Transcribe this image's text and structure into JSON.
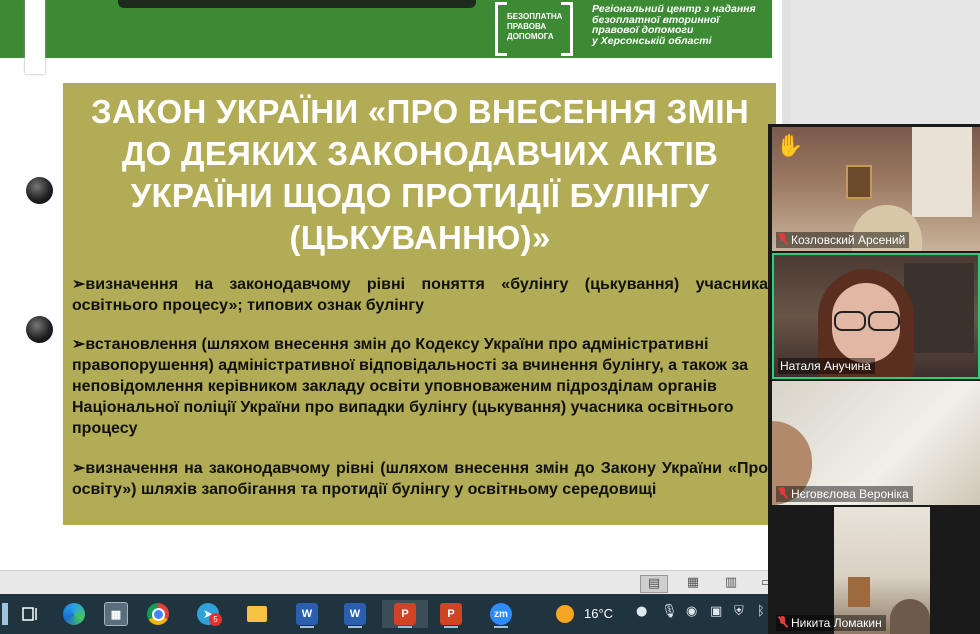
{
  "slide": {
    "title": "ЗАКОН УКРАЇНИ «ПРО ВНЕСЕННЯ ЗМІН ДО ДЕЯКИХ ЗАКОНОДАВЧИХ АКТІВ УКРАЇНИ ЩОДО ПРОТИДІЇ БУЛІНГУ (ЦЬКУВАННЮ)»",
    "bullets": [
      "➢визначення на законодавчому рівні поняття «булінгу (цькування) учасника освітнього процесу»; типових ознак булінгу",
      "➢встановлення (шляхом внесення змін до Кодексу України про адміністративні правопорушення) адміністративної відповідальності за вчинення булінгу, а також за неповідомлення керівником закладу освіти уповноваженим підрозділам органів Національної поліції України про випадки булінгу (цькування) учасника освітнього процесу",
      "➢визначення на законодавчому рівні (шляхом внесення змін до Закону України «Про освіту») шляхів запобігання та протидії булінгу у освітньому середовищі"
    ],
    "brand_lines": [
      "БЕЗОПЛАТНА",
      "ПРАВОВА",
      "ДОПОМОГА"
    ],
    "org_lines": [
      "Регіональний центр з надання",
      "безоплатної вторинної",
      "правової допомоги",
      "у Херсонській області"
    ]
  },
  "participants": [
    {
      "name": "Козловский Арсений",
      "muted": true,
      "hand_raised": true
    },
    {
      "name": "Наталя Анучина",
      "muted": false,
      "active_speaker": true
    },
    {
      "name": "Нєговєлова Вероніка",
      "muted": true
    },
    {
      "name": "Никита Ломакин",
      "muted": true
    }
  ],
  "taskbar": {
    "telegram_badge": "5",
    "weather_temp": "16°C",
    "word_letter": "W",
    "ppt_letter": "P",
    "zoom_label": "zm"
  },
  "icons": {
    "hand": "raised-hand-icon",
    "start": "windows-start-icon"
  },
  "colors": {
    "header_green": "#3d8a35",
    "content_olive": "#b1ac55",
    "taskbar": "#20343f",
    "active_border": "#26d07c"
  }
}
